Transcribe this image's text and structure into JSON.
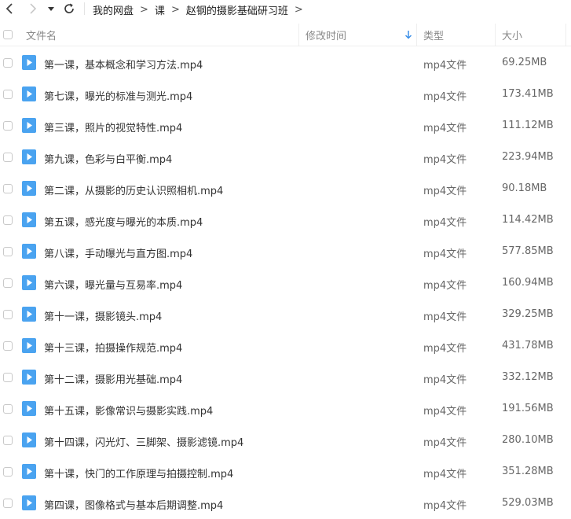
{
  "breadcrumb": {
    "items": [
      "我的网盘",
      "课",
      "赵钢的摄影基础研习班"
    ],
    "separator": ">"
  },
  "header": {
    "name_label": "文件名",
    "modified_label": "修改时间",
    "type_label": "类型",
    "size_label": "大小"
  },
  "icons": {
    "back": "chevron-left-icon",
    "forward": "chevron-right-icon",
    "dropdown": "caret-down-icon",
    "refresh": "refresh-icon",
    "sort": "arrow-down-icon",
    "file": "video-file-icon"
  },
  "colors": {
    "accent": "#3b8fe8",
    "file_icon": "#4aa3f0"
  },
  "files": [
    {
      "name": "第一课，基本概念和学习方法.mp4",
      "type": "mp4文件",
      "size": "69.25MB"
    },
    {
      "name": "第七课，曝光的标准与测光.mp4",
      "type": "mp4文件",
      "size": "173.41MB"
    },
    {
      "name": "第三课，照片的视觉特性.mp4",
      "type": "mp4文件",
      "size": "111.12MB"
    },
    {
      "name": "第九课，色彩与白平衡.mp4",
      "type": "mp4文件",
      "size": "223.94MB"
    },
    {
      "name": "第二课，从摄影的历史认识照相机.mp4",
      "type": "mp4文件",
      "size": "90.18MB"
    },
    {
      "name": "第五课，感光度与曝光的本质.mp4",
      "type": "mp4文件",
      "size": "114.42MB"
    },
    {
      "name": "第八课，手动曝光与直方图.mp4",
      "type": "mp4文件",
      "size": "577.85MB"
    },
    {
      "name": "第六课，曝光量与互易率.mp4",
      "type": "mp4文件",
      "size": "160.94MB"
    },
    {
      "name": "第十一课，摄影镜头.mp4",
      "type": "mp4文件",
      "size": "329.25MB"
    },
    {
      "name": "第十三课，拍摄操作规范.mp4",
      "type": "mp4文件",
      "size": "431.78MB"
    },
    {
      "name": "第十二课，摄影用光基础.mp4",
      "type": "mp4文件",
      "size": "332.12MB"
    },
    {
      "name": "第十五课，影像常识与摄影实践.mp4",
      "type": "mp4文件",
      "size": "191.56MB"
    },
    {
      "name": "第十四课，闪光灯、三脚架、摄影滤镜.mp4",
      "type": "mp4文件",
      "size": "280.10MB"
    },
    {
      "name": "第十课，快门的工作原理与拍摄控制.mp4",
      "type": "mp4文件",
      "size": "351.28MB"
    },
    {
      "name": "第四课，图像格式与基本后期调整.mp4",
      "type": "mp4文件",
      "size": "529.03MB"
    }
  ]
}
